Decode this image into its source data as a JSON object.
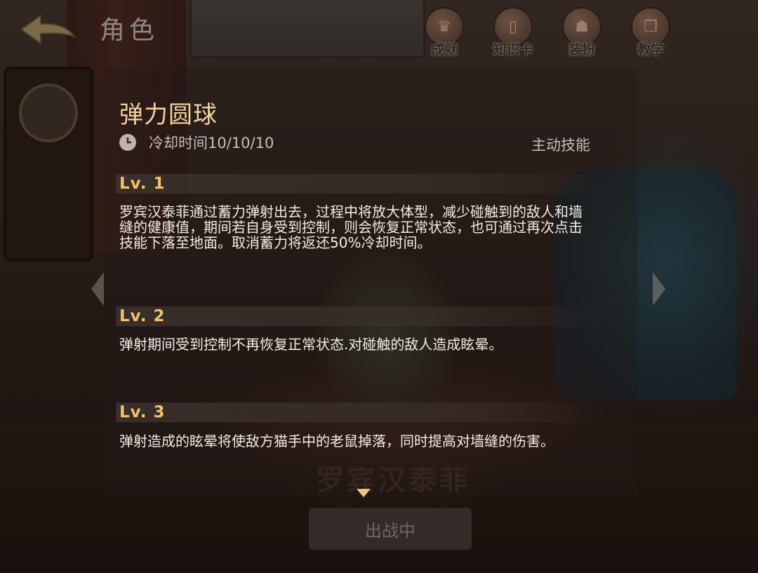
{
  "header": {
    "title": "角色",
    "menu": [
      {
        "label": "成就",
        "icon": "trophy-icon"
      },
      {
        "label": "知识卡",
        "icon": "card-icon"
      },
      {
        "label": "装扮",
        "icon": "outfit-icon"
      },
      {
        "label": "教学",
        "icon": "book-icon"
      }
    ]
  },
  "skill": {
    "name": "弹力圆球",
    "cooldown": "冷却时间10/10/10",
    "type": "主动技能",
    "levels": [
      {
        "label": "Lv. 1",
        "description": "罗宾汉泰菲通过蓄力弹射出去，过程中将放大体型，减少碰触到的敌人和墙缝的健康值，期间若自身受到控制，则会恢复正常状态，也可通过再次点击技能下落至地面。取消蓄力将返还50%冷却时间。"
      },
      {
        "label": "Lv. 2",
        "description": "弹射期间受到控制不再恢复正常状态.对碰触的敌人造成眩晕。"
      },
      {
        "label": "Lv. 3",
        "description": "弹射造成的眩晕将使敌方猫手中的老鼠掉落，同时提高对墙缝的伤害。"
      }
    ]
  },
  "character": {
    "name": "罗宾汉泰菲"
  },
  "deploy_button": {
    "label": "出战中"
  },
  "colors": {
    "skill_name": "#f0d3a0",
    "level_label": "#f0c36b",
    "text": "#f2ede4"
  }
}
